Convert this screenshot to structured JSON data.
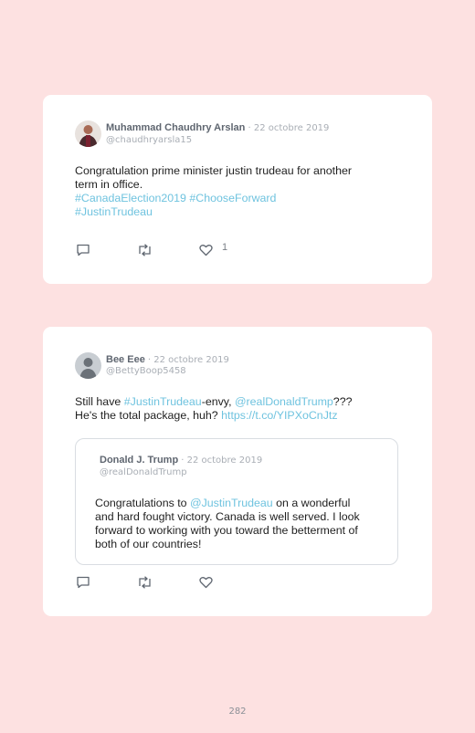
{
  "tweets": [
    {
      "name": "Muhammad Chaudhry Arslan",
      "date": "· 22 octobre 2019",
      "handle": "@chaudhryarsla15",
      "text_line1": "Congratulation prime minister justin trudeau for another",
      "text_line2": "term in office.",
      "hashtag1": "#CanadaElection2019",
      "hashtag2": "#ChooseForward",
      "hashtag3": "#JustinTrudeau",
      "like_count": "1"
    },
    {
      "name": "Bee Eee",
      "date": "· 22 octobre 2019",
      "handle": "@BettyBoop5458",
      "t1": "Still have ",
      "mention1": "#JustinTrudeau",
      "t2": "-envy, ",
      "mention2": "@realDonaldTrump",
      "t3": "???",
      "t4": "He's the total package, huh? ",
      "url": "https://t.co/YIPXoCnJtz",
      "quoted": {
        "name": "Donald J. Trump",
        "date": "· 22 octobre 2019",
        "handle": "@realDonaldTrump",
        "q1": "Congratulations to ",
        "qmention": "@JustinTrudeau",
        "q2": " on a wonderful",
        "q3": "and hard fought victory. Canada is well served. I look",
        "q4": "forward to working with you toward the betterment of",
        "q5": "both of our countries!"
      }
    }
  ],
  "page_number": "282",
  "icons": [
    "reply-icon",
    "retweet-icon",
    "like-icon"
  ],
  "colors": {
    "background": "#fde1e1",
    "link": "#6fc3df",
    "card": "#ffffff"
  }
}
